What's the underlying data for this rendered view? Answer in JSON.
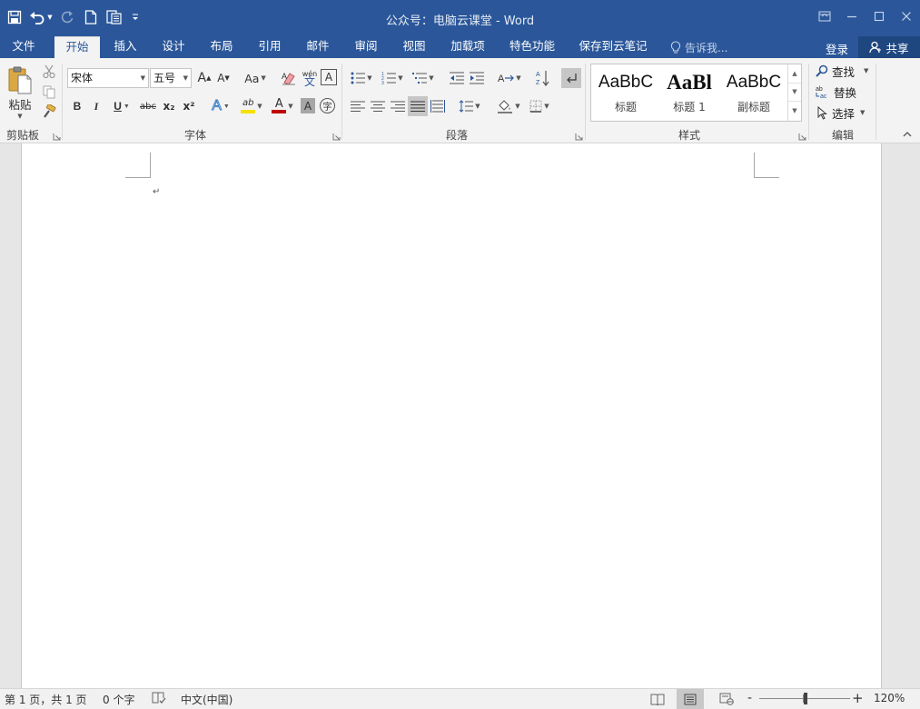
{
  "window": {
    "title": "公众号：电脑云课堂 - Word"
  },
  "quick_access": {
    "save_icon": "save-icon",
    "undo_icon": "undo-icon",
    "redo_icon": "redo-icon",
    "new_icon": "new-document-icon",
    "touch_icon": "touch-mode-icon",
    "customize_icon": "customize-qat-icon"
  },
  "tabs": [
    {
      "label": "文件"
    },
    {
      "label": "开始"
    },
    {
      "label": "插入"
    },
    {
      "label": "设计"
    },
    {
      "label": "布局"
    },
    {
      "label": "引用"
    },
    {
      "label": "邮件"
    },
    {
      "label": "审阅"
    },
    {
      "label": "视图"
    },
    {
      "label": "加载项"
    },
    {
      "label": "特色功能"
    },
    {
      "label": "保存到云笔记"
    }
  ],
  "active_tab": "开始",
  "tell_me": {
    "placeholder": "告诉我..."
  },
  "account": {
    "login_label": "登录",
    "share_label": "共享"
  },
  "ribbon": {
    "clipboard": {
      "label": "剪贴板",
      "paste_label": "粘贴"
    },
    "font": {
      "label": "字体",
      "font_name": "宋体",
      "font_size": "五号",
      "case_label": "Aa",
      "bold": "B",
      "italic": "I",
      "underline": "U",
      "strike": "abc",
      "subscript": "x₂",
      "superscript": "x²",
      "grow_label": "A",
      "shrink_label": "A",
      "effects_label": "A",
      "font_color_label": "A",
      "shading_label": "A",
      "phonetic_top": "wén",
      "phonetic_bottom": "文",
      "border_label": "A",
      "enclose_label": "字",
      "highlight_label": "ab"
    },
    "paragraph": {
      "label": "段落"
    },
    "styles": {
      "label": "样式",
      "items": [
        {
          "sample": "AaBbC",
          "name": "标题"
        },
        {
          "sample": "AaBl",
          "name": "标题 1"
        },
        {
          "sample": "AaBbC",
          "name": "副标题"
        }
      ]
    },
    "editing": {
      "label": "编辑",
      "find_label": "查找",
      "replace_label": "替换",
      "select_label": "选择"
    }
  },
  "document": {
    "paragraph_mark": "↵"
  },
  "status": {
    "page_info": "第 1 页，共 1 页",
    "word_count": "0 个字",
    "language": "中文(中国)",
    "zoom": "120%",
    "zoom_out": "-",
    "zoom_in": "+"
  }
}
